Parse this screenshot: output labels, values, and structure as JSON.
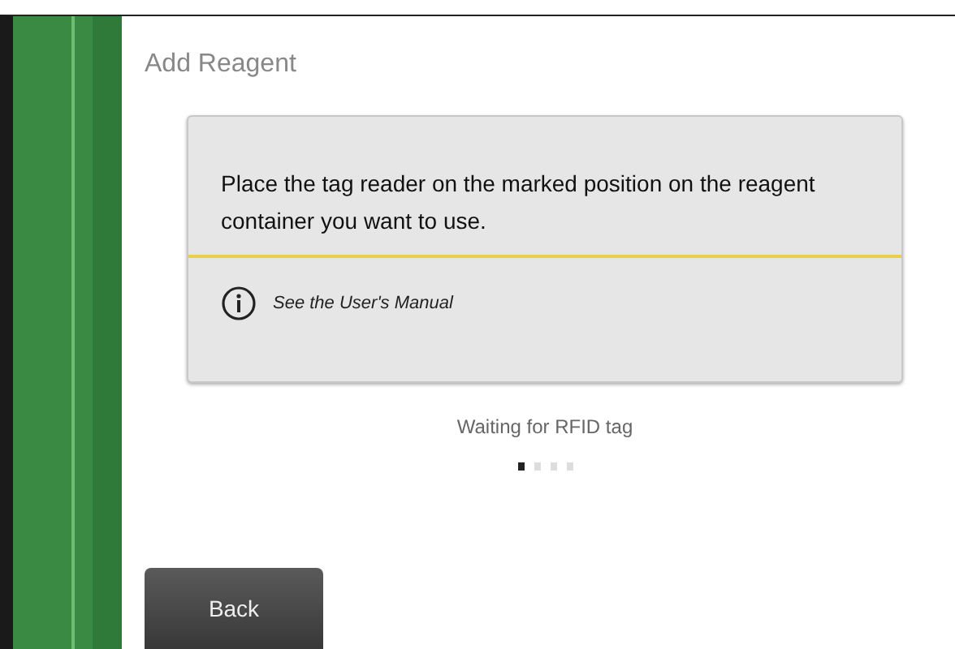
{
  "title": "Add Reagent",
  "instruction": "Place the tag reader on the marked position on the reagent container you want to use.",
  "manual_link": "See the User's Manual",
  "status": "Waiting for RFID tag",
  "progress_dots": [
    {
      "selected": true
    },
    {
      "selected": false
    },
    {
      "selected": false
    },
    {
      "selected": false
    }
  ],
  "buttons": [
    {
      "label": "Back"
    }
  ]
}
